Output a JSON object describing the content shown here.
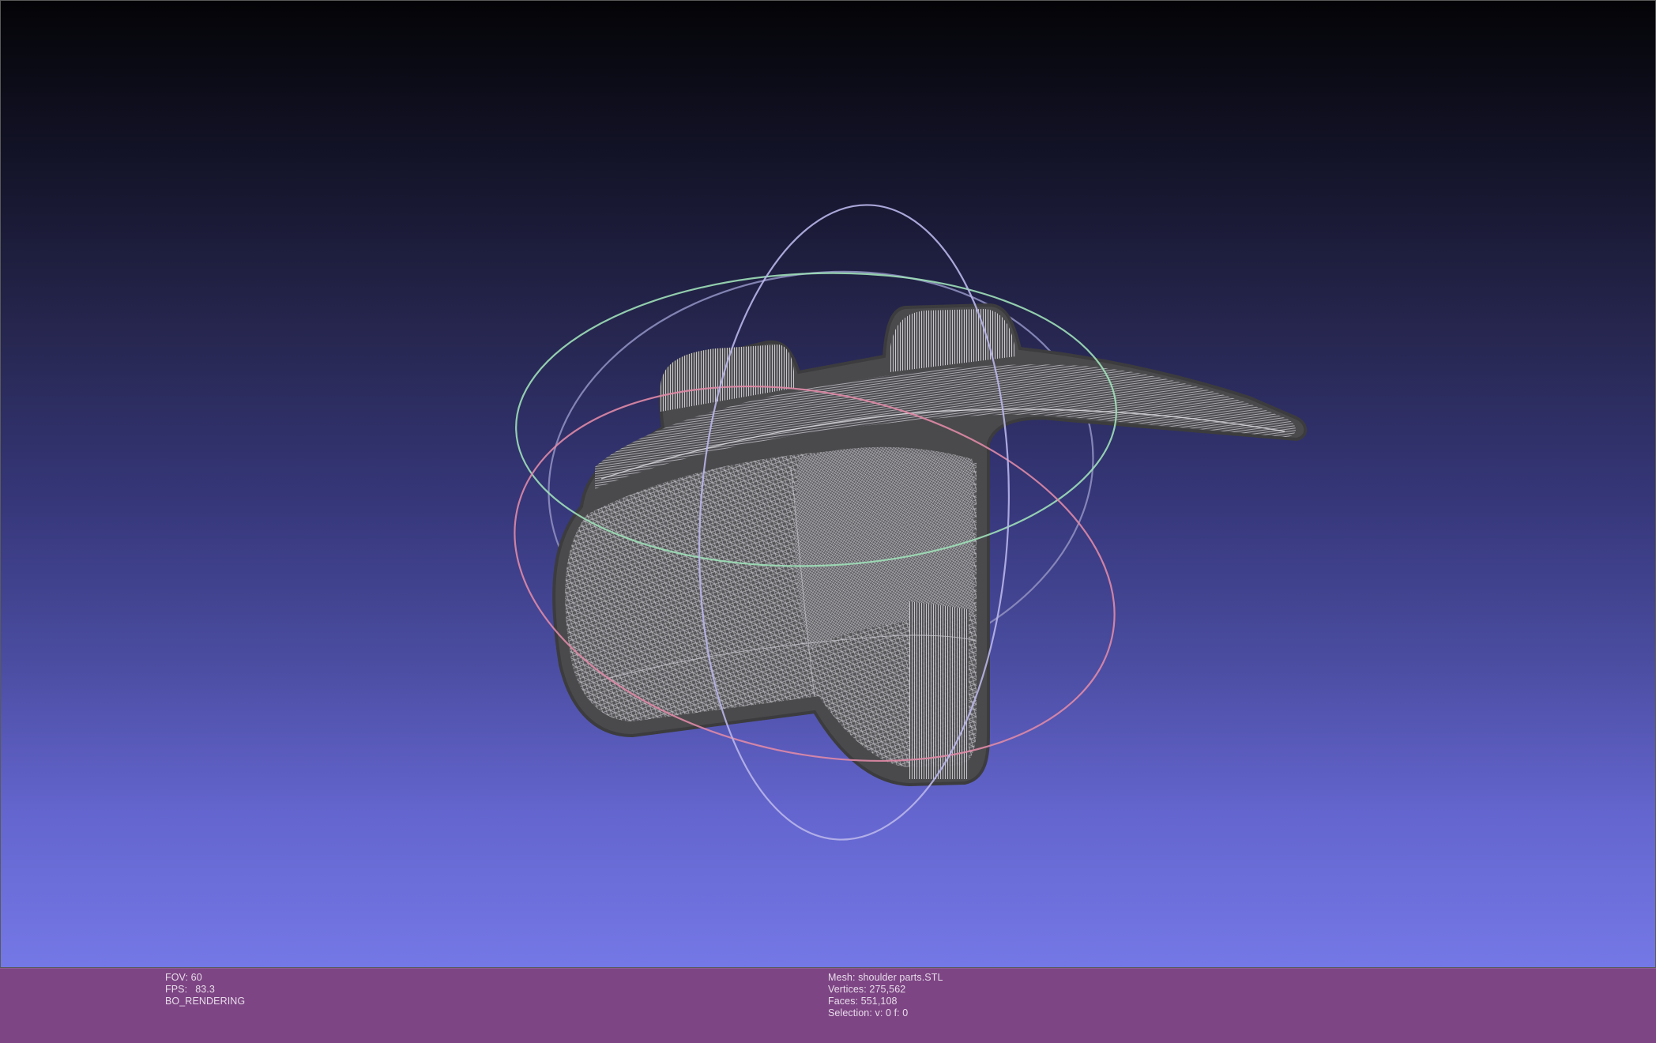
{
  "viewer": {
    "fov": "FOV: 60",
    "fps_label": "FPS:",
    "fps_value": "83.3",
    "render_mode": "BO_RENDERING"
  },
  "mesh": {
    "name": "Mesh: shoulder parts.STL",
    "vertices": "Vertices: 275,562",
    "faces": "Faces: 551,108",
    "selection": "Selection: v: 0 f: 0"
  },
  "colors": {
    "background_top": "#040407",
    "background_bottom": "#7478e6",
    "infobar": "#7d4584",
    "mesh_fill": "#4a4a4c",
    "wireframe": "#d9d9dd",
    "trackball_x": "#e08aa6",
    "trackball_y": "#9ee0b8",
    "trackball_z": "#b9b6ea"
  },
  "icons": {
    "trackball": "trackball-rings-icon"
  }
}
